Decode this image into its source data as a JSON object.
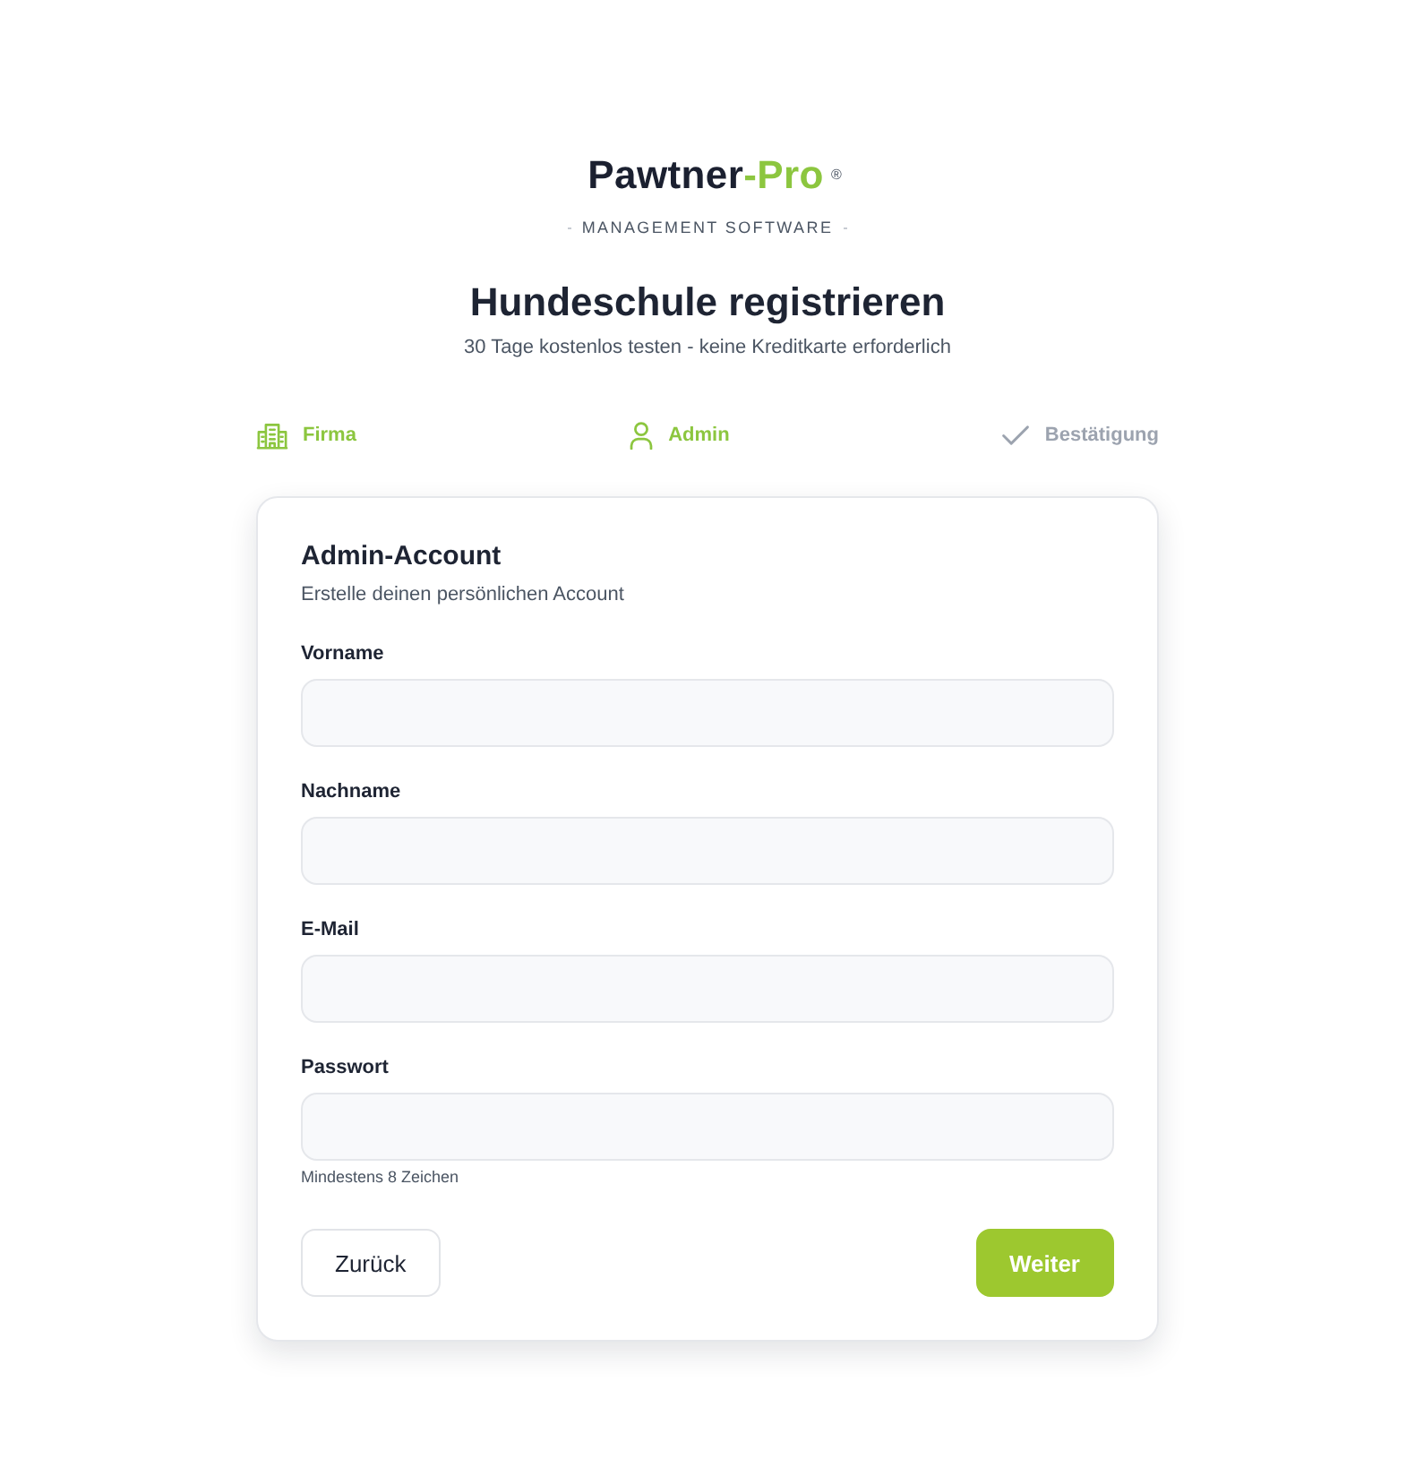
{
  "brand": {
    "name": "Pawtner",
    "accent": "-Pro",
    "mark": "®",
    "tagline": "MANAGEMENT SOFTWARE"
  },
  "heading": {
    "title": "Hundeschule registrieren",
    "subtitle": "30 Tage kostenlos testen - keine Kreditkarte erforderlich"
  },
  "steps": [
    {
      "label": "Firma",
      "kind": "company",
      "active": true
    },
    {
      "label": "Admin",
      "kind": "account",
      "active": true
    },
    {
      "label": "Bestätigung",
      "kind": "confirm",
      "active": false
    }
  ],
  "form": {
    "title": "Admin-Account",
    "subtitle": "Erstelle deinen persönlichen Account",
    "fields": [
      {
        "label": "Vorname"
      },
      {
        "label": "Nachname"
      },
      {
        "label": "E-Mail"
      },
      {
        "label": "Passwort",
        "hint": "Mindestens 8 Zeichen"
      }
    ],
    "buttons": [
      {
        "label": "Zurück",
        "kind": "secondary"
      },
      {
        "label": "Weiter",
        "kind": "primary"
      }
    ]
  }
}
